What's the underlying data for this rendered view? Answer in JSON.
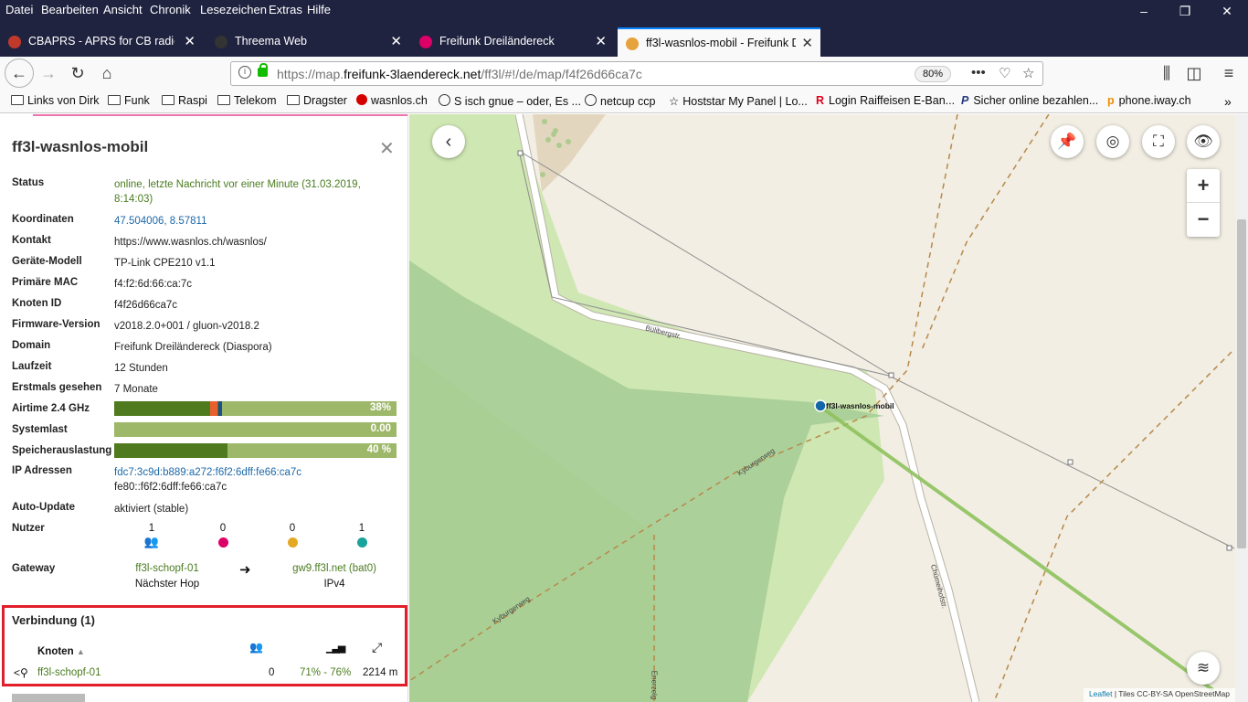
{
  "menu": [
    "Datei",
    "Bearbeiten",
    "Ansicht",
    "Chronik",
    "Lesezeichen",
    "Extras",
    "Hilfe"
  ],
  "window_controls": {
    "minimize": "–",
    "restore": "❐",
    "close": "✕"
  },
  "tabs": [
    {
      "title": "CBAPRS - APRS for CB radio",
      "favicon_color": "#c0392b"
    },
    {
      "title": "Threema Web",
      "favicon_color": "#333333"
    },
    {
      "title": "Freifunk Dreiländereck",
      "favicon_color": "#dc0067"
    },
    {
      "title": "ff3l-wasnlos-mobil - Freifunk D",
      "favicon_color": "#e6a23c",
      "active": true
    }
  ],
  "url": {
    "prefix": "https://map.",
    "host": "freifunk-3laendereck.net",
    "path": "/ff3l/#!/de/map/f4f26d66ca7c",
    "zoom": "80%"
  },
  "bookmarks": [
    {
      "label": "Links von Dirk",
      "icon": "folder"
    },
    {
      "label": "Funk",
      "icon": "folder"
    },
    {
      "label": "Raspi",
      "icon": "folder"
    },
    {
      "label": "Telekom",
      "icon": "folder"
    },
    {
      "label": "Dragster",
      "icon": "folder"
    },
    {
      "label": "wasnlos.ch",
      "icon": "red-dot"
    },
    {
      "label": "S isch gnue – oder, Es ...",
      "icon": "globe"
    },
    {
      "label": "netcup ccp",
      "icon": "globe"
    },
    {
      "label": "Hoststar My Panel | Lo...",
      "icon": "star"
    },
    {
      "label": "Login Raiffeisen E-Ban...",
      "icon": "raiffeisen"
    },
    {
      "label": "Sicher online bezahlen...",
      "icon": "paypal"
    },
    {
      "label": "phone.iway.ch",
      "icon": "iway"
    }
  ],
  "node": {
    "title": "ff3l-wasnlos-mobil",
    "fields": [
      {
        "label": "Status",
        "value": "online, letzte Nachricht vor einer Minute (31.03.2019,",
        "value2": "8:14:03)",
        "style": "green"
      },
      {
        "label": "Koordinaten",
        "value": "47.504006, 8.57811",
        "style": "blue"
      },
      {
        "label": "Kontakt",
        "value": "https://www.wasnlos.ch/wasnlos/"
      },
      {
        "label": "Geräte-Modell",
        "value": "TP-Link CPE210 v1.1"
      },
      {
        "label": "Primäre MAC",
        "value": "f4:f2:6d:66:ca:7c"
      },
      {
        "label": "Knoten ID",
        "value": "f4f26d66ca7c"
      },
      {
        "label": "Firmware-Version",
        "value": "v2018.2.0+001 / gluon-v2018.2"
      },
      {
        "label": "Domain",
        "value": "Freifunk Dreiländereck (Diaspora)"
      },
      {
        "label": "Laufzeit",
        "value": "12 Stunden"
      },
      {
        "label": "Erstmals gesehen",
        "value": "7 Monate"
      }
    ],
    "airtime": {
      "label": "Airtime 2.4 GHz",
      "value": 0.38,
      "text": "38%"
    },
    "systemlast": {
      "label": "Systemlast",
      "value": 0.0,
      "text": "0.00"
    },
    "speicher": {
      "label": "Speicherauslastung",
      "value": 0.4,
      "text": "40 %"
    },
    "ip": {
      "label": "IP Adressen",
      "v6_global": "fdc7:3c9d:b889:a272:f6f2:6dff:fe66:ca7c",
      "v6_link": "fe80::f6f2:6dff:fe66:ca7c"
    },
    "autoupdate": {
      "label": "Auto-Update",
      "value": "aktiviert (stable)"
    },
    "users": {
      "label": "Nutzer",
      "cols": [
        {
          "count": "1",
          "icon": "users-icon",
          "color": "#222222"
        },
        {
          "count": "0",
          "icon": "dot",
          "color": "#dc0067"
        },
        {
          "count": "0",
          "icon": "dot",
          "color": "#e5a823"
        },
        {
          "count": "1",
          "icon": "dot",
          "color": "#1aa39a"
        }
      ]
    },
    "gateway": {
      "label": "Gateway",
      "hop": "ff3l-schopf-01",
      "hop_caption": "Nächster Hop",
      "arrow": "➜",
      "gw": "gw9.ff3l.net (bat0)",
      "gw_caption": "IPv4"
    }
  },
  "connections": {
    "title": "Verbindung (1)",
    "col_knoten": "Knoten",
    "rows": [
      {
        "name": "ff3l-schopf-01",
        "clients": "0",
        "tq": "71% - 76%",
        "distance": "2214 m"
      }
    ]
  },
  "map": {
    "node_label": "ff3l-wasnlos-mobil",
    "streets": [
      "Bülibergstr.",
      "Kyburgerweg",
      "Kyburgerweg",
      "Chümeihofstr.",
      "Enerzelg"
    ],
    "attribution_link": "Leaflet",
    "attribution_rest": " | Tiles CC-BY-SA OpenStreetMap"
  }
}
